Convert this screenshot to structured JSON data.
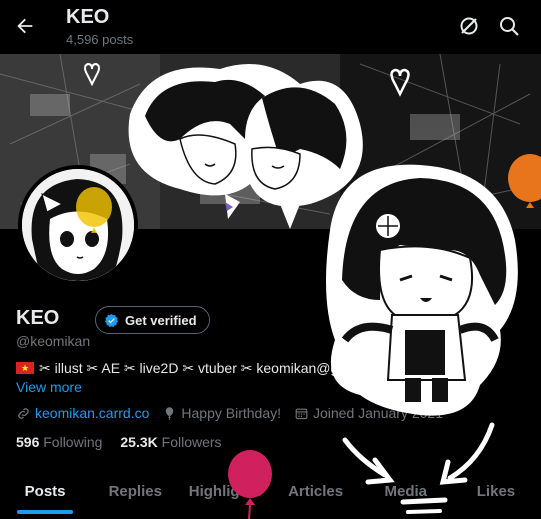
{
  "header": {
    "back_icon": "arrow-left-icon",
    "title": "KEO",
    "post_count": "4,596 posts",
    "icons": [
      "grok-icon",
      "search-icon"
    ]
  },
  "profile": {
    "display_name": "KEO",
    "handle": "@keomikan",
    "verify_label": "Get verified",
    "bio_flag": "vietnam-flag-icon",
    "bio_text": "✂ illust ✂ AE ✂ live2D ✂ vtuber ✂ keomikan@gmail.com",
    "view_more": "View more",
    "website": "keomikan.carrd.co",
    "birthday": "Happy Birthday!",
    "joined": "Joined January 2021",
    "following_count": "596",
    "following_label": "Following",
    "followers_count": "25.3K",
    "followers_label": "Followers"
  },
  "tabs": [
    {
      "label": "Posts",
      "active": true
    },
    {
      "label": "Replies",
      "active": false
    },
    {
      "label": "Highlights",
      "active": false
    },
    {
      "label": "Articles",
      "active": false
    },
    {
      "label": "Media",
      "active": false
    },
    {
      "label": "Likes",
      "active": false
    }
  ],
  "colors": {
    "accent": "#1d9bf0",
    "muted": "#71767b",
    "text": "#e7e9ea",
    "background": "#000000",
    "balloon_yellow": "#f2c200",
    "balloon_orange": "#e8741c",
    "balloon_pink": "#d1205e"
  }
}
